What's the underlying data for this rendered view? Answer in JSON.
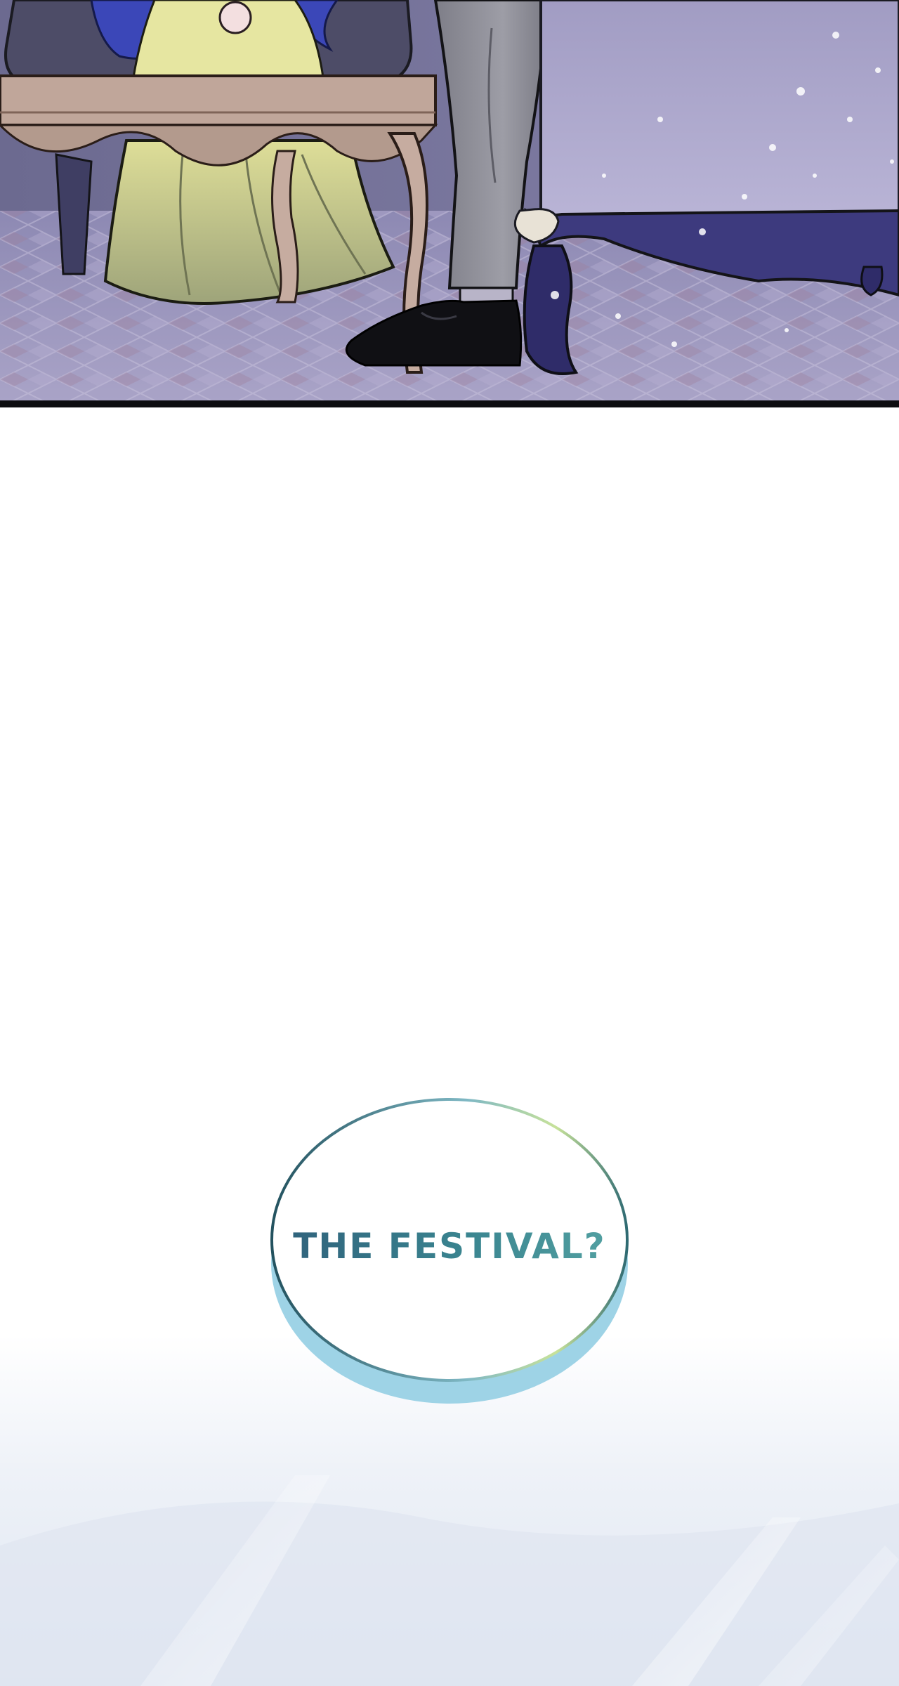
{
  "dialogue": {
    "line": "THE FESTIVAL?"
  },
  "palette": {
    "panel_night": "#7a789f",
    "floor_tile": "#a6a0c4",
    "dress": "#c9c98b",
    "trousers": "#8d8d96",
    "shoe": "#101014",
    "hair": "#3b47b8",
    "bubble_edge": "#23525f",
    "bubble_shadow": "#9ed3e6",
    "text_teal": "#3b7d86"
  }
}
